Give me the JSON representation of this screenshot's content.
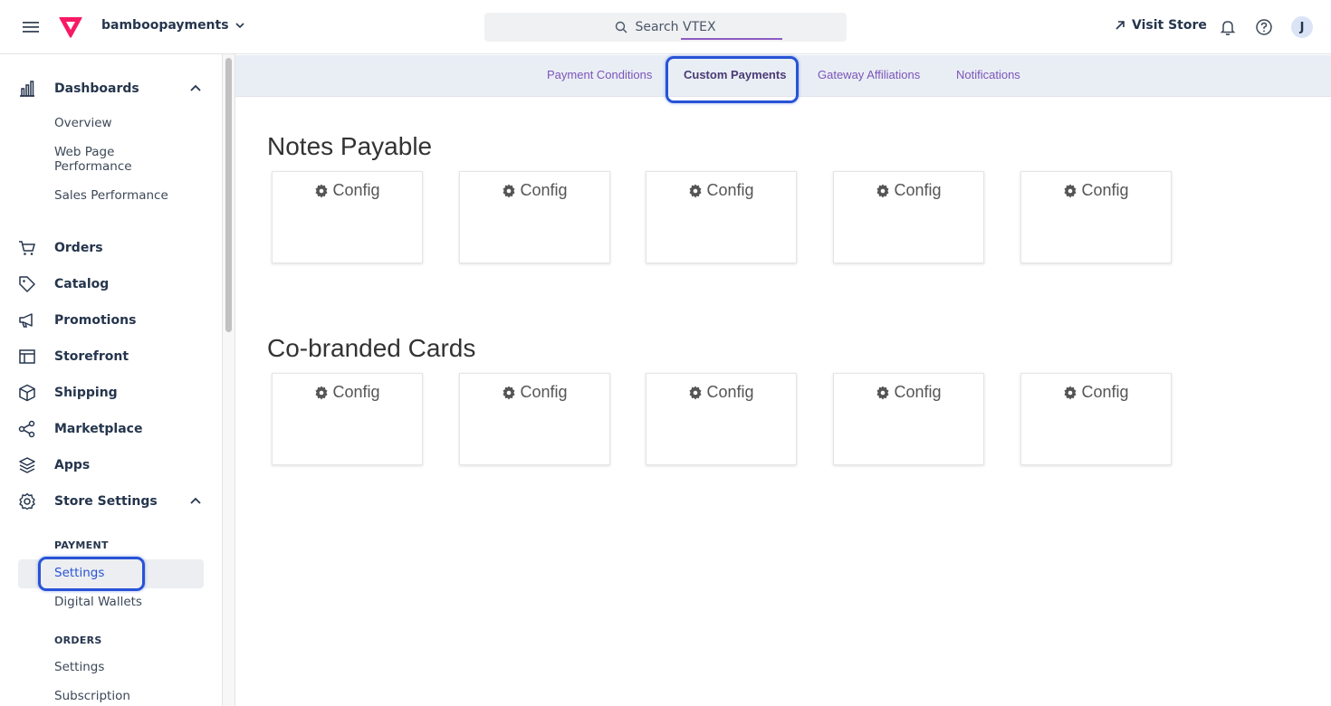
{
  "header": {
    "account_name": "bamboopayments",
    "search_placeholder": "Search VTEX",
    "visit_store": "Visit Store",
    "avatar_initial": "J"
  },
  "sidebar": {
    "dashboards": {
      "label": "Dashboards",
      "items": [
        "Overview",
        "Web Page Performance",
        "Sales Performance"
      ]
    },
    "nav": [
      {
        "label": "Orders",
        "icon": "cart-icon"
      },
      {
        "label": "Catalog",
        "icon": "tag-icon"
      },
      {
        "label": "Promotions",
        "icon": "megaphone-icon"
      },
      {
        "label": "Storefront",
        "icon": "layout-icon"
      },
      {
        "label": "Shipping",
        "icon": "box-icon"
      },
      {
        "label": "Marketplace",
        "icon": "share-icon"
      },
      {
        "label": "Apps",
        "icon": "layers-icon"
      }
    ],
    "store_settings": {
      "label": "Store Settings",
      "payment_section": "PAYMENT",
      "payment_items": [
        "Settings",
        "Digital Wallets"
      ],
      "orders_section": "ORDERS",
      "orders_items": [
        "Settings",
        "Subscription"
      ]
    }
  },
  "tabs": [
    {
      "label": "Payment Conditions",
      "active": false
    },
    {
      "label": "Custom Payments",
      "active": true
    },
    {
      "label": "Gateway Affiliations",
      "active": false
    },
    {
      "label": "Notifications",
      "active": false
    }
  ],
  "sections": [
    {
      "title": "Notes Payable",
      "cards": [
        "Config",
        "Config",
        "Config",
        "Config",
        "Config"
      ]
    },
    {
      "title": "Co-branded Cards",
      "cards": [
        "Config",
        "Config",
        "Config",
        "Config",
        "Config"
      ]
    }
  ],
  "colors": {
    "accent_purple": "#7c54b8",
    "highlight_blue": "#2853d6",
    "brand_red": "#f71963"
  }
}
